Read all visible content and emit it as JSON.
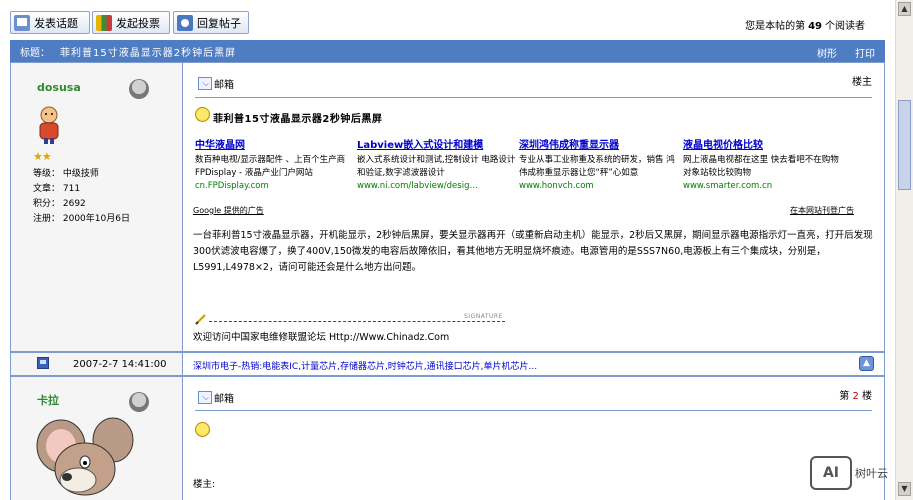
{
  "toolbar": {
    "new_topic": "发表话题",
    "new_poll": "发起投票",
    "reply": "回复帖子",
    "visit_prefix": "您是本帖的第",
    "visit_count": "49",
    "visit_suffix": "个阅读者"
  },
  "thread": {
    "title_label": "标题：",
    "title": "菲利普15寸液晶显示器2秒钟后黑屏",
    "tree_label": "树形",
    "print_label": "打印"
  },
  "post1": {
    "username": "dosusa",
    "stars": "★★",
    "level": "等级：  中级技师",
    "articles": "文章：  711",
    "points": "积分：  2692",
    "registered": "注册：  2000年10月6日",
    "mailbox": "邮箱",
    "floor_label": "楼主",
    "title": "菲利普15寸液晶显示器2秒钟后黑屏",
    "ads": [
      {
        "title": "中华液晶网",
        "desc": "数百种电视/显示器配件 、上百个生产商 FPDisplay - 液晶产业门户网站",
        "url": "cn.FPDisplay.com"
      },
      {
        "title": "Labview嵌入式设计和建模",
        "desc": "嵌入式系统设计和测试,控制设计 电路设计和验证,数字滤波器设计",
        "url": "www.ni.com/labview/desig…"
      },
      {
        "title": "深圳鸿伟成称重显示器",
        "desc": "专业从事工业称重及系统的研发，销售 鸿伟成称重显示器让您“秤”心如意",
        "url": "www.honvch.com"
      },
      {
        "title": "液晶电视价格比较",
        "desc": "网上液晶电视都在这里 快去看吧不在购物对象站较比较购物",
        "url": "www.smarter.com.cn"
      }
    ],
    "google_label": "Google 提供的广告",
    "advertise_label": "在本网站刊登广告",
    "body": "一台菲利普15寸液晶显示器，开机能显示，2秒钟后黑屏，要关显示器再开（或重新启动主机）能显示，2秒后又黑屏，期间显示器电源指示灯一直亮，打开后发现300伏滤波电容爆了，换了400V,150微发的电容后故障依旧，看其他地方无明显烧坏痕迹。电源管用的是SSS7N60,电源板上有三个集成块，分别是，L5991,L4978×2，请问可能还会是什么地方出问题。",
    "signature_label": "SIGNATURE",
    "signature": "欢迎访问中国家电维修联盟论坛  Http://Www.Chinadz.Com"
  },
  "footer1": {
    "time": "2007-2-7 14:41:00",
    "links": "深圳市电子-热销:电能表IC,计量芯片,存储器芯片,时钟芯片,通讯接口芯片,单片机芯片..."
  },
  "post2": {
    "username": "卡拉",
    "mailbox": "邮箱",
    "floor_prefix": "第",
    "floor_num": "2",
    "floor_suffix": "楼",
    "body_start": "楼主:"
  },
  "watermark": {
    "logo": "AI",
    "text": "树叶云"
  },
  "colors": {
    "title_bar": "#4f7dc4",
    "border": "#7f9ccf",
    "link": "#0000cc",
    "url": "#008000",
    "username": "#2e8b2e"
  }
}
